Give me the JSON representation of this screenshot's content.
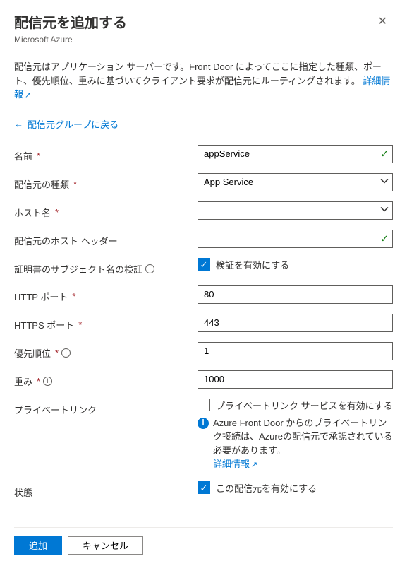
{
  "header": {
    "title": "配信元を追加する",
    "subtitle": "Microsoft Azure"
  },
  "description": "配信元はアプリケーション サーバーです。Front Door によってここに指定した種類、ポート、優先順位、重みに基づいてクライアント要求が配信元にルーティングされます。",
  "moreInfo": "詳細情報",
  "backLink": "配信元グループに戻る",
  "fields": {
    "name": {
      "label": "名前",
      "value": "appService"
    },
    "originType": {
      "label": "配信元の種類",
      "value": "App Service"
    },
    "hostName": {
      "label": "ホスト名",
      "value": ""
    },
    "hostHeader": {
      "label": "配信元のホスト ヘッダー",
      "value": ""
    },
    "certSubject": {
      "label": "証明書のサブジェクト名の検証",
      "checkboxLabel": "検証を有効にする"
    },
    "httpPort": {
      "label": "HTTP ポート",
      "value": "80"
    },
    "httpsPort": {
      "label": "HTTPS ポート",
      "value": "443"
    },
    "priority": {
      "label": "優先順位",
      "value": "1"
    },
    "weight": {
      "label": "重み",
      "value": "1000"
    },
    "privateLink": {
      "label": "プライベートリンク",
      "checkboxLabel": "プライベートリンク サービスを有効にする",
      "note": "Azure Front Door からのプライベートリンク接続は、Azureの配信元で承認されている必要があります。",
      "noteLink": "詳細情報"
    },
    "status": {
      "label": "状態",
      "checkboxLabel": "この配信元を有効にする"
    }
  },
  "footer": {
    "add": "追加",
    "cancel": "キャンセル"
  }
}
